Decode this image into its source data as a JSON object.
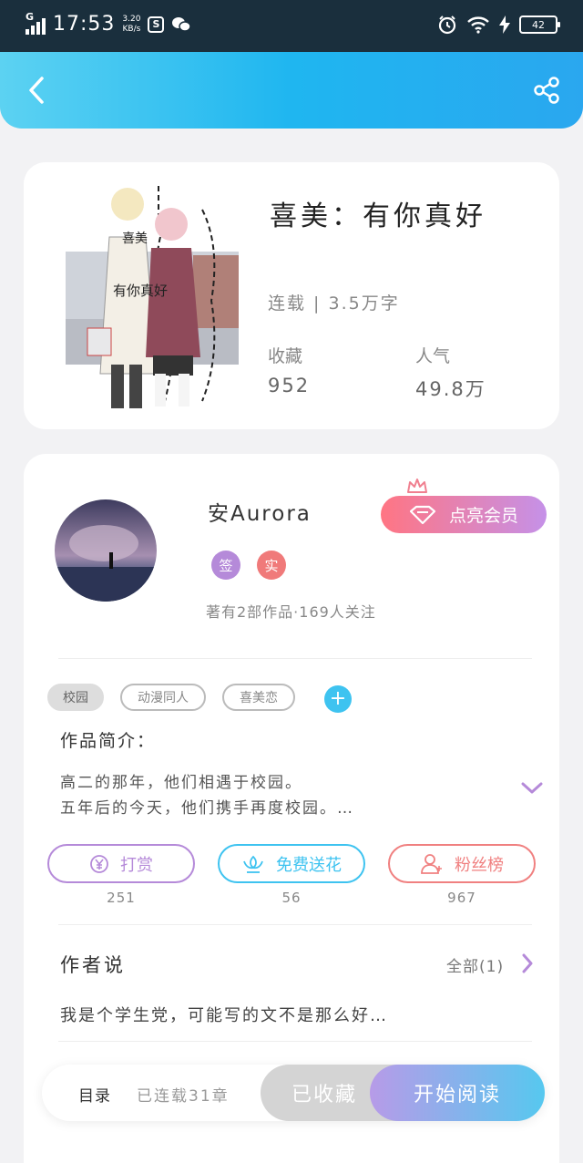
{
  "status": {
    "network": "G",
    "time": "17:53",
    "speed_value": "3.20",
    "speed_unit": "KB/s",
    "battery": "42",
    "icons": [
      "signal-icon",
      "app-s-icon",
      "wechat-icon",
      "alarm-icon",
      "wifi-icon",
      "charging-icon",
      "battery-icon"
    ]
  },
  "header": {
    "back_icon": "chevron-left-icon",
    "share_icon": "share-icon"
  },
  "book": {
    "title": "喜美：有你真好",
    "status_words": "连载 | 3.5万字",
    "favorites_label": "收藏",
    "favorites_value": "952",
    "popularity_label": "人气",
    "popularity_value": "49.8万",
    "cover_text_1": "喜美",
    "cover_text_2": "有你真好"
  },
  "author": {
    "name": "安Aurora",
    "badge_sign": "签",
    "badge_real": "实",
    "stats": "著有2部作品·169人关注",
    "vip_label": "点亮会员"
  },
  "tags": [
    "校园",
    "动漫同人",
    "喜美恋"
  ],
  "intro": {
    "title": "作品简介：",
    "line1": "高二的那年，他们相遇于校园。",
    "line2": "五年后的今天，他们携手再度校园。…"
  },
  "actions": [
    {
      "label": "打赏",
      "count": "251",
      "color": "#b58ad9"
    },
    {
      "label": "免费送花",
      "count": "56",
      "color": "#3ec3f0"
    },
    {
      "label": "粉丝榜",
      "count": "967",
      "color": "#f08080"
    }
  ],
  "author_says": {
    "title": "作者说",
    "all_label": "全部(1)",
    "text": "我是个学生党，可能写的文不是那么好…"
  },
  "bottom": {
    "toc": "目录",
    "chapters": "已连载31章",
    "favorited": "已收藏",
    "read": "开始阅读"
  }
}
